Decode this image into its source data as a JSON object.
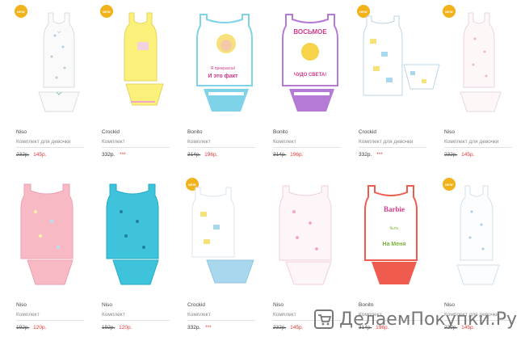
{
  "products": [
    {
      "badge": "NEW",
      "brand": "Niso",
      "subtitle": "Комплект для девочки",
      "old_price": "232р.",
      "new_price": "145р."
    },
    {
      "badge": "NEW",
      "brand": "Crockid",
      "subtitle": "Комплект",
      "price": "332р.",
      "stars": "***"
    },
    {
      "brand": "Bonito",
      "subtitle": "Комплект",
      "old_price": "314р.",
      "new_price": "196р.",
      "print_lines": [
        "Я прекрасна!",
        "И это факт"
      ]
    },
    {
      "brand": "Bonito",
      "subtitle": "Комплект",
      "old_price": "314р.",
      "new_price": "196р.",
      "print_lines": [
        "ВОСЬМОЕ",
        "ЧУДО СВЕТА!"
      ]
    },
    {
      "badge": "NEW",
      "brand": "Crockid",
      "subtitle": "Комплект для девочки",
      "price": "332р.",
      "stars": "***"
    },
    {
      "badge": "NEW",
      "brand": "Niso",
      "subtitle": "Комплект для девочки",
      "old_price": "232р.",
      "new_price": "145р."
    },
    {
      "brand": "Niso",
      "subtitle": "Комплект",
      "old_price": "192р.",
      "new_price": "120р."
    },
    {
      "brand": "Niso",
      "subtitle": "Комплект",
      "old_price": "192р.",
      "new_price": "120р."
    },
    {
      "badge": "NEW",
      "brand": "Crockid",
      "subtitle": "Комплект",
      "price": "332р.",
      "stars": "***"
    },
    {
      "brand": "Niso",
      "subtitle": "Комплект",
      "old_price": "232р.",
      "new_price": "145р."
    },
    {
      "brand": "Bonito",
      "subtitle": "Комплект",
      "old_price": "314р.",
      "new_price": "196р.",
      "print_lines": [
        "Barbie",
        "быть",
        "На Меня"
      ]
    },
    {
      "badge": "NEW",
      "brand": "Niso",
      "subtitle": "Комплект для девочки",
      "old_price": "232р.",
      "new_price": "145р."
    }
  ],
  "watermark": "ДелаемПокупки.Ру"
}
